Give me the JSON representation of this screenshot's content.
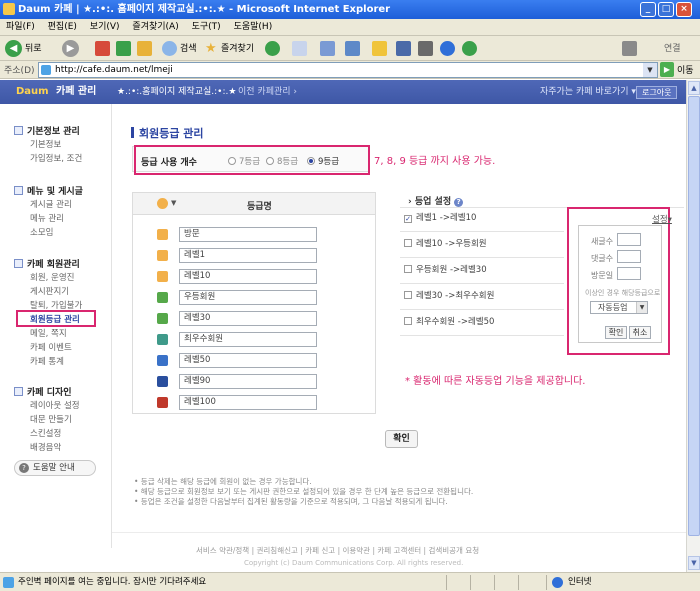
{
  "window": {
    "title": "Daum 카페 | ★.:•:. 홈페이지 제작교실.:•:.★ - Microsoft Internet Explorer"
  },
  "menu": [
    "파일(F)",
    "편집(E)",
    "보기(V)",
    "즐겨찾기(A)",
    "도구(T)",
    "도움말(H)"
  ],
  "toolbar": {
    "back": "뒤로",
    "search": "검색",
    "favorites": "즐겨찾기",
    "connect": "연결"
  },
  "address": {
    "label": "주소(D)",
    "url": "http://cafe.daum.net/lmeji",
    "go": "이동"
  },
  "cafe_header": {
    "logo": "Daum",
    "manage": "카페 관리",
    "cafe_name": "★.:•:.홈페이지 제작교실.:•:.★",
    "prev_link": "이전 카페관리 ›",
    "goto": "자주가는 카페 바로가기 ▾",
    "logout": "로그아웃"
  },
  "sidebar": {
    "sections": [
      {
        "title": "기본정보 관리",
        "items": [
          "기본정보",
          "가입정보, 조건"
        ]
      },
      {
        "title": "메뉴 및 게시글",
        "items": [
          "게시글 관리",
          "메뉴 관리",
          "소모임"
        ]
      },
      {
        "title": "카페 회원관리",
        "items": [
          "회원, 운영진",
          "게시판지기",
          "탈퇴, 가입불가",
          "회원등급 관리",
          "메일, 쪽지",
          "카페 이벤트",
          "카페 통계"
        ]
      },
      {
        "title": "카페 디자인",
        "items": [
          "레이아웃 설정",
          "대문 만들기",
          "스킨설정",
          "배경음악"
        ]
      }
    ],
    "help": "도움말 안내"
  },
  "main": {
    "title": "회원등급 관리",
    "level_count_label": "등급 사용 개수",
    "level_options": [
      "7등급",
      "8등급",
      "9등급"
    ],
    "level_selected": "9등급",
    "annotation_1": "7, 8, 9 등급 까지 사용 가능.",
    "grade_header": "등급명",
    "grades": [
      "방문",
      "레벨1",
      "레벨10",
      "우등회원",
      "레벨30",
      "최우수회원",
      "레벨50",
      "레벨90",
      "레벨100"
    ],
    "grade_icon_colors": [
      "#f2b04a",
      "#f2b04a",
      "#f2b04a",
      "#56a84a",
      "#56a84a",
      "#3f9a8a",
      "#3a72c8",
      "#2a4f9e",
      "#c0392b"
    ],
    "levelup_title": "› 등업 설정",
    "levelups": [
      "레벨1 ->레벨10",
      "레벨10 ->우등회원",
      "우등회원 ->레벨30",
      "레벨30 ->최우수회원",
      "최우수회원 ->레벨50"
    ],
    "levelup_checked": [
      true,
      false,
      false,
      false,
      false
    ],
    "setting_link": "설정▾",
    "cond_labels": [
      "새글수",
      "댓글수",
      "방문일"
    ],
    "cond_note": "이상인 경우 해당등급으로",
    "cond_select": "자동등업",
    "cond_ok": "확인",
    "cond_cancel": "취소",
    "annotation_2": "* 활동에 따른 자동등업 기능을 제공합니다.",
    "confirm": "확인",
    "notes": [
      "• 등급 삭제는 해당 등급에 회원이 없는 경우 가능합니다.",
      "• 해당 등급으로 회원정보 보기 또는 게시판 권한으로 설정되어 있을 경우 한 단계 높은 등급으로 전환됩니다.",
      "• 등업은 조건을 설정한 다음날부터 집계된 활동량을 기준으로 적용되며, 그 다음날 적용되게 됩니다."
    ]
  },
  "footer": {
    "links": "서비스 약관/정책  |  권리침해신고  |  카페 신고  |  이용약관  |  카페 고객센터  |  검색비공개 요청",
    "copy": "Copyright (c) Daum Communications Corp. All rights reserved."
  },
  "status": {
    "message": "주인벽 페이지를 여는 중입니다. 잠시만 기다려주세요",
    "zone": "인터넷"
  }
}
